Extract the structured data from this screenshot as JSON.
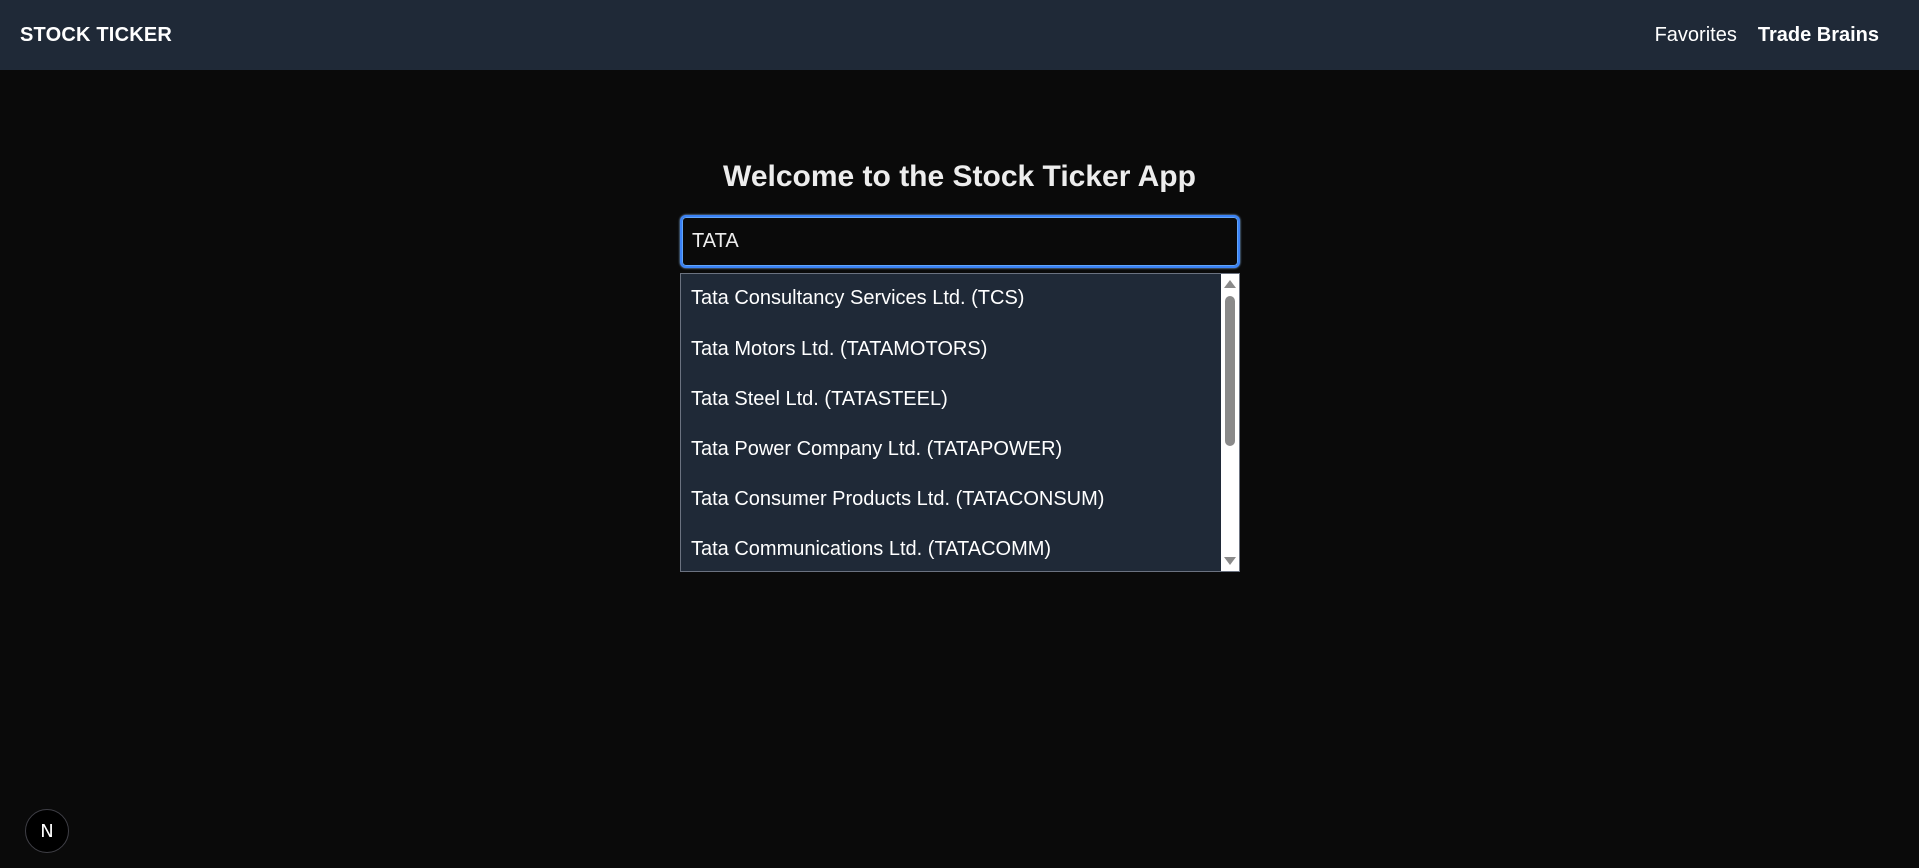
{
  "navbar": {
    "brand": "STOCK TICKER",
    "links": [
      {
        "label": "Favorites"
      },
      {
        "label": "Trade Brains"
      }
    ]
  },
  "main": {
    "title": "Welcome to the Stock Ticker App",
    "search": {
      "value": "TATA",
      "placeholder": ""
    },
    "suggestions": [
      "Tata Consultancy Services Ltd. (TCS)",
      "Tata Motors Ltd. (TATAMOTORS)",
      "Tata Steel Ltd. (TATASTEEL)",
      "Tata Power Company Ltd. (TATAPOWER)",
      "Tata Consumer Products Ltd. (TATACONSUM)",
      "Tata Communications Ltd. (TATACOMM)"
    ]
  },
  "badge": {
    "label": "N",
    "icon": "nextjs-logo-icon"
  },
  "colors": {
    "background": "#0a0a0a",
    "navbar": "#1f2937",
    "dropdown": "#1f2937",
    "focus_ring": "#3b82f6"
  }
}
